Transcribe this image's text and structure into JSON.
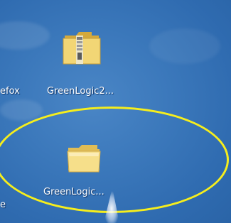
{
  "desktop": {
    "icons": [
      {
        "label": "efox",
        "icon": "application-shortcut-icon"
      },
      {
        "label": "GreenLogic2...",
        "icon": "zip-folder-icon"
      },
      {
        "label": "GreenLogic...",
        "icon": "folder-icon"
      },
      {
        "label": "e",
        "icon": "partial-icon"
      }
    ]
  },
  "colors": {
    "wallpaper": "#3b78bb",
    "highlight_ring": "#f6ee1c",
    "folder": "#f2d675"
  }
}
